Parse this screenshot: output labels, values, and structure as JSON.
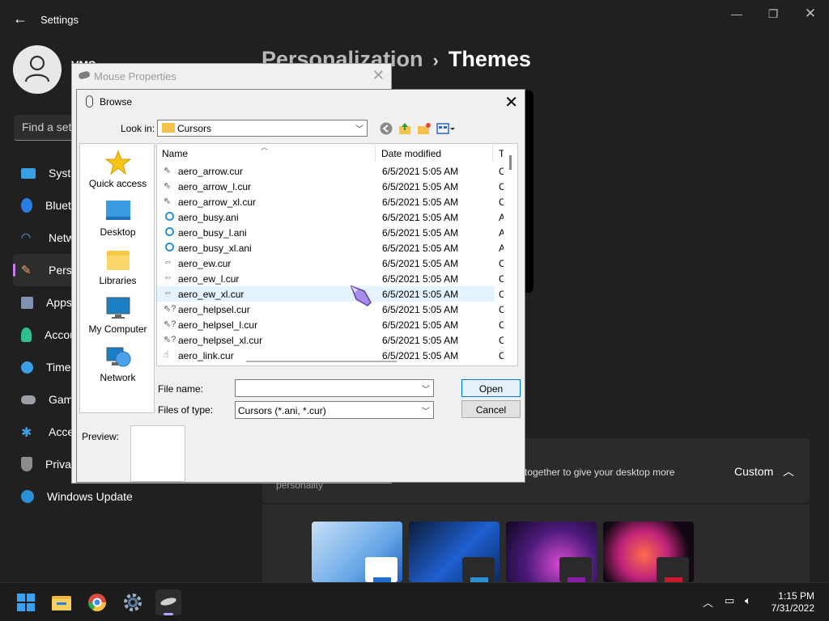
{
  "settings": {
    "app_title": "Settings",
    "user_name": "VMS",
    "search_placeholder": "Find a setting",
    "nav": [
      {
        "label": "System"
      },
      {
        "label": "Bluetooth & devices"
      },
      {
        "label": "Network & internet"
      },
      {
        "label": "Personalization",
        "selected": true
      },
      {
        "label": "Apps"
      },
      {
        "label": "Accounts"
      },
      {
        "label": "Time & language"
      },
      {
        "label": "Gaming"
      },
      {
        "label": "Accessibility"
      },
      {
        "label": "Privacy & security"
      },
      {
        "label": "Windows Update"
      }
    ],
    "breadcrumb": {
      "parent": "Personalization",
      "separator": "›",
      "current": "Themes"
    },
    "themes_desc_line1": "together to give your desktop more",
    "themes_desc_line2": "personality",
    "custom_label": "Custom",
    "accent": "#c87be6"
  },
  "mouse_properties": {
    "title": "Mouse Properties"
  },
  "browse": {
    "title": "Browse",
    "look_in_label": "Look in:",
    "look_in_value": "Cursors",
    "places": [
      "Quick access",
      "Desktop",
      "Libraries",
      "My Computer",
      "Network"
    ],
    "columns": {
      "name": "Name",
      "date": "Date modified",
      "type": "Ty"
    },
    "files": [
      {
        "name": "aero_arrow.cur",
        "date": "6/5/2021 5:05 AM",
        "type": "Cu",
        "icon": "arrow"
      },
      {
        "name": "aero_arrow_l.cur",
        "date": "6/5/2021 5:05 AM",
        "type": "Cu",
        "icon": "arrow"
      },
      {
        "name": "aero_arrow_xl.cur",
        "date": "6/5/2021 5:05 AM",
        "type": "Cu",
        "icon": "arrow"
      },
      {
        "name": "aero_busy.ani",
        "date": "6/5/2021 5:05 AM",
        "type": "Ar",
        "icon": "busy"
      },
      {
        "name": "aero_busy_l.ani",
        "date": "6/5/2021 5:05 AM",
        "type": "Ar",
        "icon": "busy"
      },
      {
        "name": "aero_busy_xl.ani",
        "date": "6/5/2021 5:05 AM",
        "type": "Ar",
        "icon": "busy"
      },
      {
        "name": "aero_ew.cur",
        "date": "6/5/2021 5:05 AM",
        "type": "Cu",
        "icon": "ew"
      },
      {
        "name": "aero_ew_l.cur",
        "date": "6/5/2021 5:05 AM",
        "type": "Cu",
        "icon": "ew"
      },
      {
        "name": "aero_ew_xl.cur",
        "date": "6/5/2021 5:05 AM",
        "type": "Cu",
        "icon": "ew",
        "selected": true
      },
      {
        "name": "aero_helpsel.cur",
        "date": "6/5/2021 5:05 AM",
        "type": "Cu",
        "icon": "help"
      },
      {
        "name": "aero_helpsel_l.cur",
        "date": "6/5/2021 5:05 AM",
        "type": "Cu",
        "icon": "help"
      },
      {
        "name": "aero_helpsel_xl.cur",
        "date": "6/5/2021 5:05 AM",
        "type": "Cu",
        "icon": "help"
      },
      {
        "name": "aero_link.cur",
        "date": "6/5/2021 5:05 AM",
        "type": "Cu",
        "icon": "link"
      }
    ],
    "file_name_label": "File name:",
    "file_name_value": "",
    "files_of_type_label": "Files of type:",
    "files_of_type_value": "Cursors (*.ani, *.cur)",
    "open_button": "Open",
    "cancel_button": "Cancel",
    "preview_label": "Preview:"
  },
  "taskbar": {
    "time": "1:15 PM",
    "date": "7/31/2022"
  }
}
